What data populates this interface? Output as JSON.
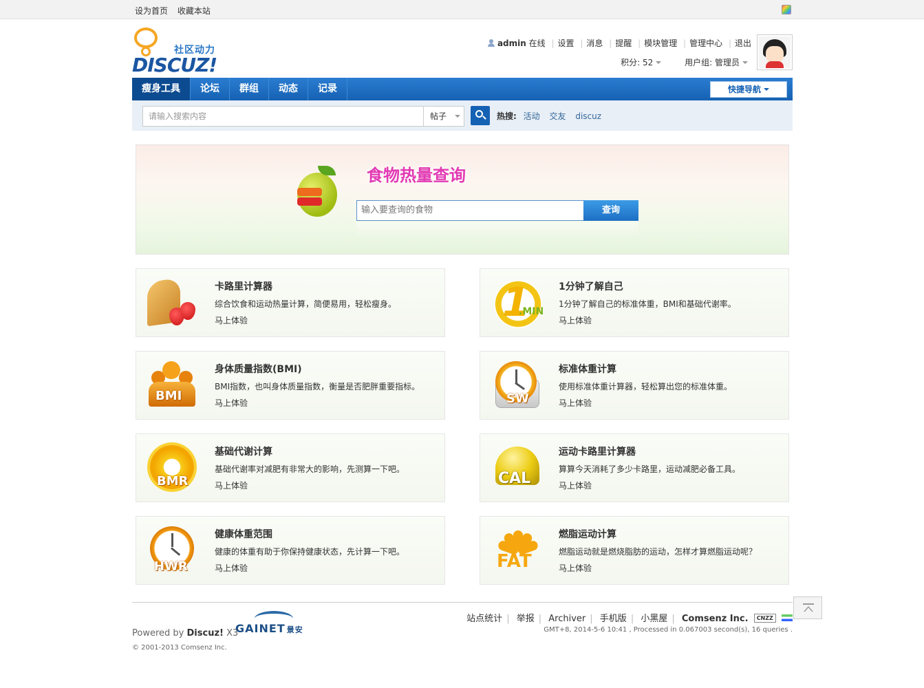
{
  "topbar": {
    "set_home": "设为首页",
    "bookmark": "收藏本站"
  },
  "logo": {
    "sub": "社区动力",
    "word": "DISCUZ!"
  },
  "user": {
    "name": "admin",
    "status": "在线",
    "links": [
      "设置",
      "消息",
      "提醒",
      "模块管理",
      "管理中心",
      "退出"
    ],
    "points_label": "积分: 52",
    "group_label": "用户组: 管理员"
  },
  "nav": {
    "items": [
      "瘦身工具",
      "论坛",
      "群组",
      "动态",
      "记录"
    ],
    "quick": "快捷导航"
  },
  "search": {
    "placeholder": "请输入搜索内容",
    "type": "帖子",
    "hot_label": "热搜:",
    "hot": [
      "活动",
      "交友",
      "discuz"
    ]
  },
  "banner": {
    "title": "食物热量查询",
    "placeholder": "输入要查询的食物",
    "button": "查询"
  },
  "cards": [
    {
      "title": "卡路里计算器",
      "desc": "综合饮食和运动热量计算，简便易用，轻松瘦身。",
      "go": "马上体验"
    },
    {
      "title": "1分钟了解自己",
      "desc": "1分钟了解自己的标准体重，BMI和基础代谢率。",
      "go": "马上体验",
      "badge": ".MIN"
    },
    {
      "title": "身体质量指数(BMI)",
      "desc": "BMI指数，也叫身体质量指数，衡量是否肥胖重要指标。",
      "go": "马上体验",
      "badge": "BMI"
    },
    {
      "title": "标准体重计算",
      "desc": "使用标准体重计算器，轻松算出您的标准体重。",
      "go": "马上体验",
      "badge": "SW"
    },
    {
      "title": "基础代谢计算",
      "desc": "基础代谢率对减肥有非常大的影响，先测算一下吧。",
      "go": "马上体验",
      "badge": "BMR"
    },
    {
      "title": "运动卡路里计算器",
      "desc": "算算今天消耗了多少卡路里，运动减肥必备工具。",
      "go": "马上体验",
      "badge": "CAL"
    },
    {
      "title": "健康体重范围",
      "desc": "健康的体重有助于你保持健康状态，先计算一下吧。",
      "go": "马上体验",
      "badge": "HWR"
    },
    {
      "title": "燃脂运动计算",
      "desc": "燃脂运动就是燃烧脂肪的运动，怎样才算燃脂运动呢？",
      "go": "马上体验",
      "badge": "FAT"
    }
  ],
  "footer": {
    "powered_pre": "Powered by",
    "powered_name": "Discuz!",
    "powered_ver": "X3",
    "copyright": "© 2001-2013 Comsenz Inc.",
    "gainet": "GAINET",
    "gainet_cn": "景安",
    "links": [
      "站点统计",
      "举报",
      "Archiver",
      "手机版",
      "小黑屋"
    ],
    "company": "Comsenz Inc.",
    "badge": "CNZZ",
    "info": "GMT+8, 2014-5-6 10:41 , Processed in 0.067003 second(s), 16 queries ."
  },
  "icons": {
    "card_icons": [
      "bread-strawberry-icon",
      "one-minute-icon",
      "bmi-people-icon",
      "sw-clock-icon",
      "bmr-gear-icon",
      "cal-helmet-icon",
      "hwr-clock-icon",
      "fat-sun-icon"
    ],
    "accent": "#1561b3",
    "banner_title_color": "#e23ab3"
  }
}
